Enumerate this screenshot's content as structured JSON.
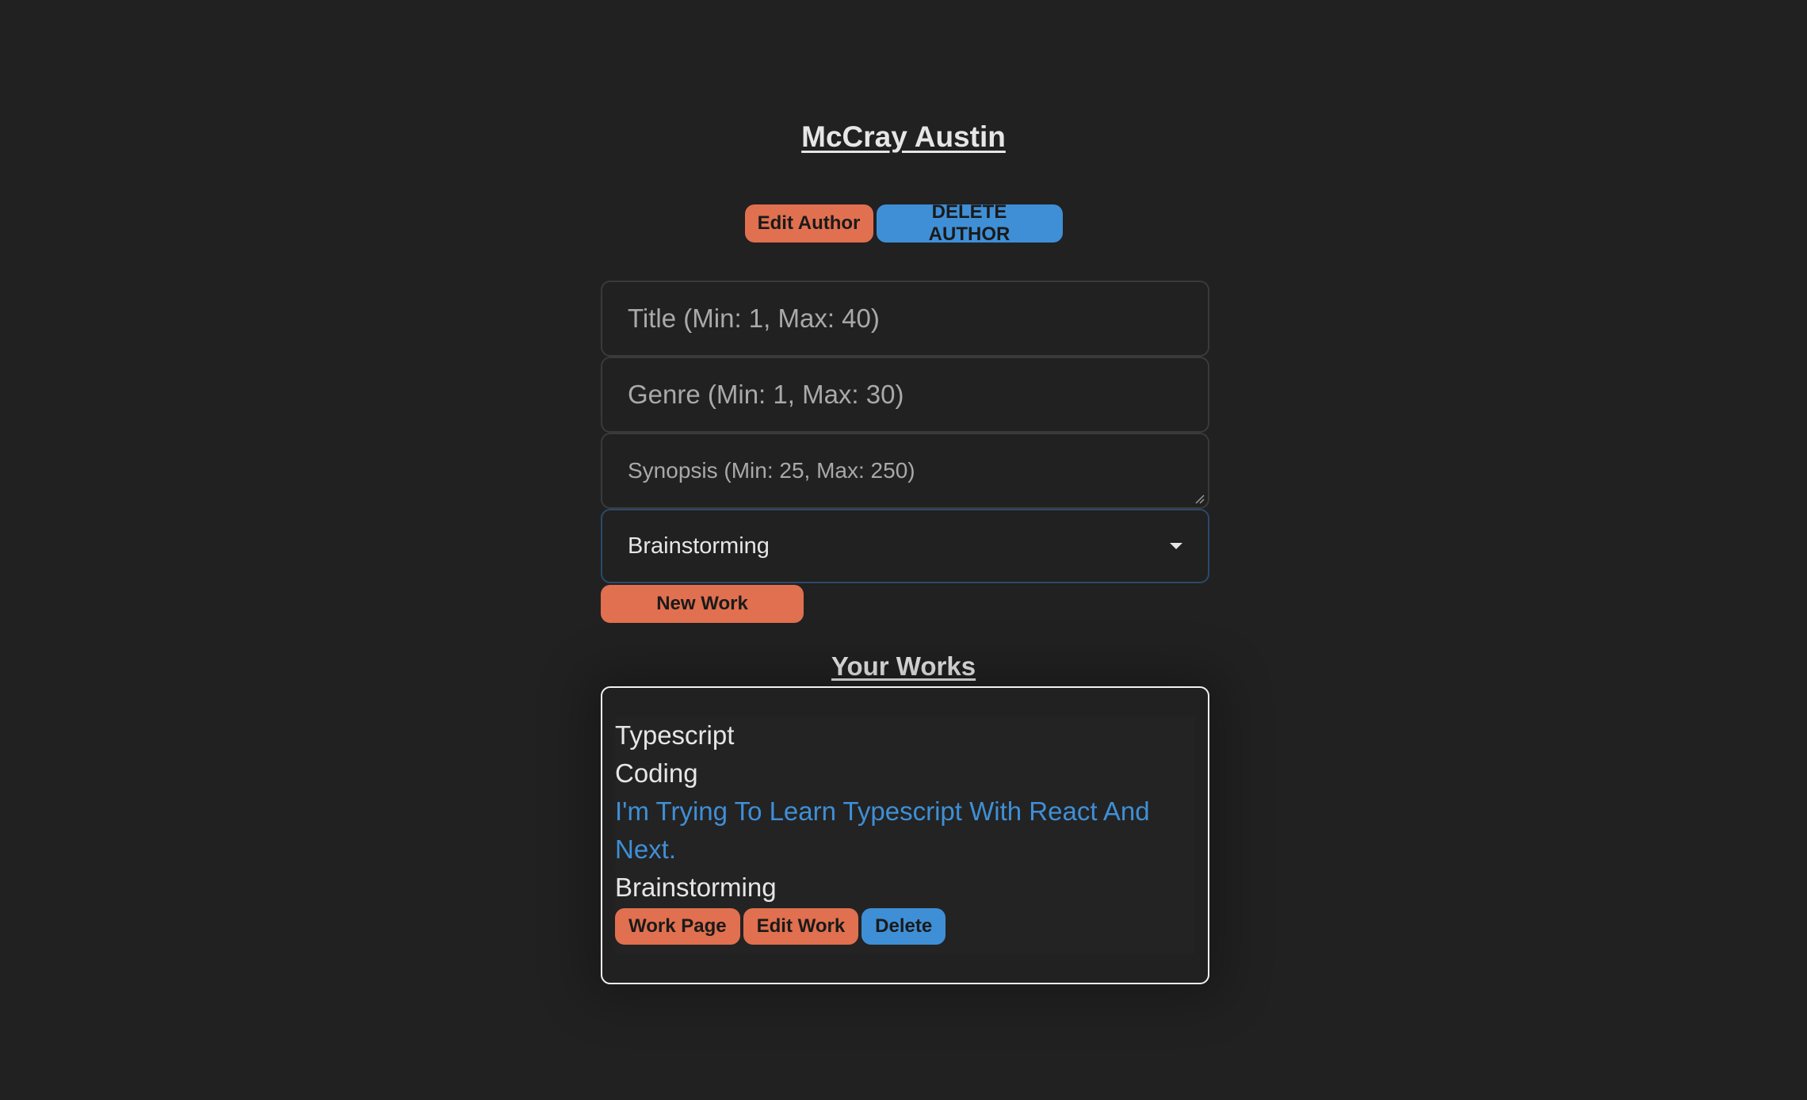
{
  "author": {
    "name": "McCray Austin",
    "edit_label": "Edit Author",
    "delete_label": "DELETE AUTHOR"
  },
  "form": {
    "title_placeholder": "Title (Min: 1, Max: 40)",
    "genre_placeholder": "Genre (Min: 1, Max: 30)",
    "synopsis_placeholder": "Synopsis (Min: 25, Max: 250)",
    "status_selected": "Brainstorming",
    "submit_label": "New Work"
  },
  "works": {
    "heading": "Your Works",
    "items": [
      {
        "title": "Typescript",
        "genre": "Coding",
        "synopsis": "I'm Trying To Learn Typescript With React And Next.",
        "status": "Brainstorming",
        "work_page_label": "Work Page",
        "edit_label": "Edit Work",
        "delete_label": "Delete"
      }
    ]
  },
  "colors": {
    "background": "#212121",
    "accent_orange": "#e0704f",
    "accent_blue": "#3f8fd6",
    "text": "#e6e6e6"
  }
}
